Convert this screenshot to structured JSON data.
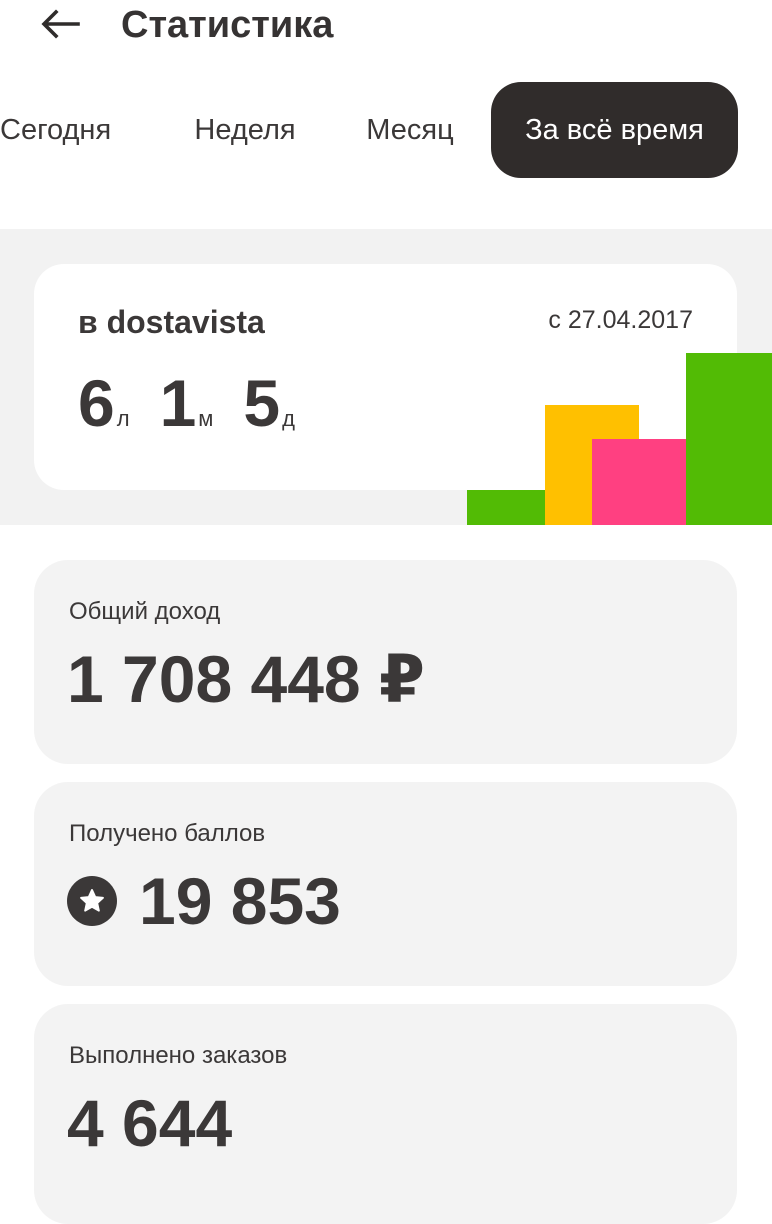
{
  "header": {
    "title": "Статистика",
    "back_icon": "arrow-left-icon"
  },
  "tabs": [
    {
      "label": "Сегодня",
      "active": false
    },
    {
      "label": "Неделя",
      "active": false
    },
    {
      "label": "Месяц",
      "active": false
    },
    {
      "label": "За всё время",
      "active": true
    }
  ],
  "tenure": {
    "label": "в dostavista",
    "since": "с 27.04.2017",
    "years": "6",
    "years_unit": "л",
    "months": "1",
    "months_unit": "м",
    "days": "5",
    "days_unit": "д"
  },
  "decor_colors": {
    "green": "#52bb05",
    "yellow": "#ffc000",
    "pink": "#ff4081"
  },
  "income": {
    "label": "Общий доход",
    "value": "1 708 448 ₽"
  },
  "points": {
    "label": "Получено баллов",
    "value": "19 853",
    "icon": "star-icon"
  },
  "orders": {
    "label": "Выполнено заказов",
    "value": "4 644"
  }
}
